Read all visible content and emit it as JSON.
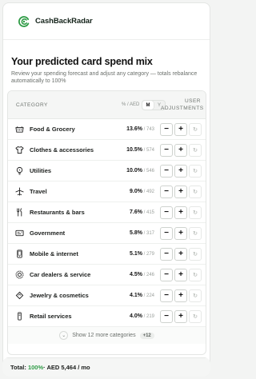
{
  "brand": {
    "name": "CashBackRadar",
    "logo_icon": "cashbackradar-logo-icon",
    "accent": "#2e9b45"
  },
  "page": {
    "title": "Your predicted card spend mix",
    "description": "Review your spending forecast and adjust any category — totals rebalance automatically to 100%"
  },
  "table": {
    "headers": {
      "category": "CATEGORY",
      "unit": "% / AED",
      "toggle": [
        "M",
        "Y"
      ],
      "toggle_selected": "M",
      "adjustments": "USER ADJUSTMENTS"
    },
    "rows": [
      {
        "icon": "cart-icon",
        "name": "Food & Grocery",
        "pct": "13.6%",
        "amount": "743"
      },
      {
        "icon": "shirt-icon",
        "name": "Clothes & accessories",
        "pct": "10.5%",
        "amount": "574"
      },
      {
        "icon": "lightbulb-icon",
        "name": "Utilities",
        "pct": "10.0%",
        "amount": "546"
      },
      {
        "icon": "airplane-icon",
        "name": "Travel",
        "pct": "9.0%",
        "amount": "492"
      },
      {
        "icon": "restaurant-icon",
        "name": "Restaurants & bars",
        "pct": "7.6%",
        "amount": "415"
      },
      {
        "icon": "government-icon",
        "name": "Government",
        "pct": "5.8%",
        "amount": "317"
      },
      {
        "icon": "mobile-icon",
        "name": "Mobile & internet",
        "pct": "5.1%",
        "amount": "279"
      },
      {
        "icon": "car-service-icon",
        "name": "Car dealers & service",
        "pct": "4.5%",
        "amount": "246"
      },
      {
        "icon": "diamond-icon",
        "name": "Jewelry & cosmetics",
        "pct": "4.1%",
        "amount": "224"
      },
      {
        "icon": "retail-icon",
        "name": "Retail services",
        "pct": "4.0%",
        "amount": "219"
      }
    ],
    "buttons": {
      "minus": "−",
      "plus": "+",
      "reset": "↻"
    },
    "more": {
      "label": "Show 12 more categories",
      "badge": "+12"
    }
  },
  "footer": {
    "label": "Total:",
    "pct": "100%",
    "rest": " · AED 5,464 / mo"
  }
}
